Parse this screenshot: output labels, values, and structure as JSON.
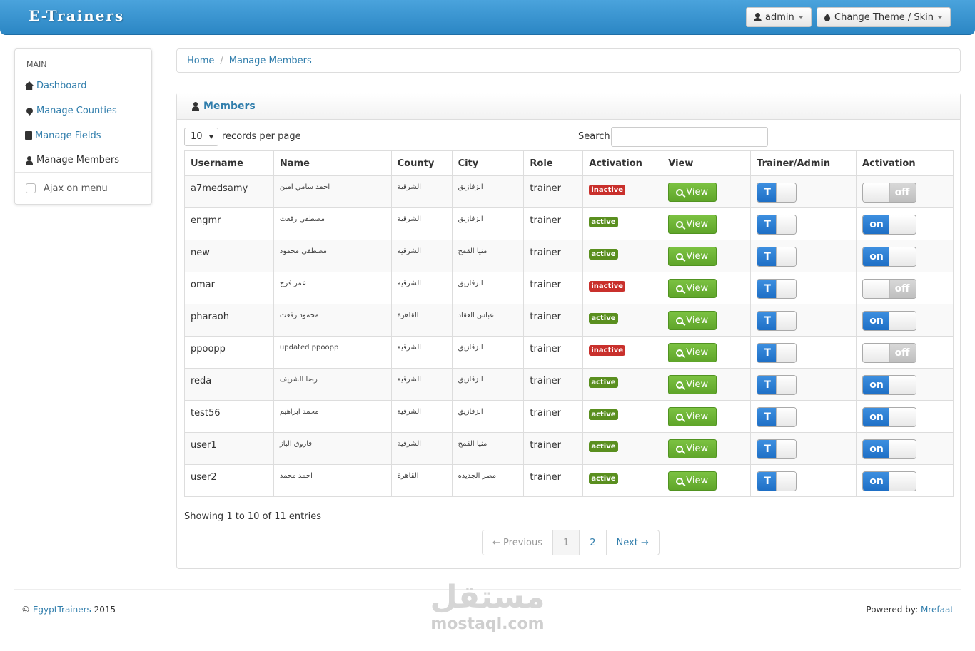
{
  "header": {
    "brand": "E-Trainers",
    "user_button": "admin",
    "theme_button": "Change Theme / Skin"
  },
  "sidebar": {
    "section": "MAIN",
    "items": [
      {
        "label": "Dashboard",
        "icon": "home-icon"
      },
      {
        "label": "Manage Counties",
        "icon": "map-marker-icon"
      },
      {
        "label": "Manage Fields",
        "icon": "book-icon"
      },
      {
        "label": "Manage Members",
        "icon": "user-icon",
        "active": true
      }
    ],
    "ajax_label": "Ajax on menu"
  },
  "breadcrumb": {
    "home": "Home",
    "current": "Manage Members"
  },
  "panel": {
    "title": "Members"
  },
  "controls": {
    "page_length": "10",
    "page_length_label": "records per page",
    "search_label": "Search:",
    "search_value": ""
  },
  "table": {
    "columns": [
      "Username",
      "Name",
      "County",
      "City",
      "Role",
      "Activation",
      "View",
      "Trainer/Admin",
      "Activation"
    ],
    "view_label": "View",
    "trainer_toggle_label": "T",
    "rows": [
      {
        "username": "a7medsamy",
        "name": "احمد سامي امين",
        "county": "الشرقية",
        "city": "الزقازيق",
        "role": "trainer",
        "status": "inactive",
        "toggle": "off"
      },
      {
        "username": "engmr",
        "name": "مصطفي رفعت",
        "county": "الشرقية",
        "city": "الزقازيق",
        "role": "trainer",
        "status": "active",
        "toggle": "on"
      },
      {
        "username": "new",
        "name": "مصطفي محمود",
        "county": "الشرقية",
        "city": "منيا القمح",
        "role": "trainer",
        "status": "active",
        "toggle": "on"
      },
      {
        "username": "omar",
        "name": "عمر فرج",
        "county": "الشرقية",
        "city": "الزقازيق",
        "role": "trainer",
        "status": "inactive",
        "toggle": "off"
      },
      {
        "username": "pharaoh",
        "name": "محمود رفعت",
        "county": "القاهرة",
        "city": "عباس العقاد",
        "role": "trainer",
        "status": "active",
        "toggle": "on"
      },
      {
        "username": "ppoopp",
        "name": "updated ppoopp",
        "county": "الشرقية",
        "city": "الزقازيق",
        "role": "trainer",
        "status": "inactive",
        "toggle": "off"
      },
      {
        "username": "reda",
        "name": "رضا الشريف",
        "county": "الشرقية",
        "city": "الزقازيق",
        "role": "trainer",
        "status": "active",
        "toggle": "on"
      },
      {
        "username": "test56",
        "name": "محمد ابراهيم",
        "county": "الشرقية",
        "city": "الزقازيق",
        "role": "trainer",
        "status": "active",
        "toggle": "on"
      },
      {
        "username": "user1",
        "name": "فاروق الباز",
        "county": "الشرقية",
        "city": "منيا القمح",
        "role": "trainer",
        "status": "active",
        "toggle": "on"
      },
      {
        "username": "user2",
        "name": "احمد محمد",
        "county": "القاهرة",
        "city": "مصر الجديده",
        "role": "trainer",
        "status": "active",
        "toggle": "on"
      }
    ]
  },
  "pagination": {
    "info": "Showing 1 to 10 of 11 entries",
    "previous": "← Previous",
    "pages": [
      "1",
      "2"
    ],
    "next": "Next →"
  },
  "footer": {
    "copyright_symbol": "©",
    "site_link": "EgyptTrainers",
    "year": "2015",
    "powered_label": "Powered by:",
    "powered_link": "Mrefaat"
  },
  "watermark": {
    "arabic": "مستقل",
    "latin": "mostaql.com"
  },
  "colors": {
    "accent": "#317eac",
    "header": "#2b86c4",
    "success": "#5fa52a",
    "danger": "#c9302c",
    "toggle_on": "#1e6fc6"
  }
}
